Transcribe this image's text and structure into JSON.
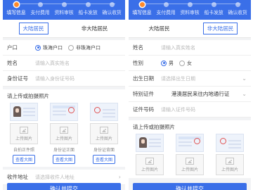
{
  "steps": [
    "填写信息",
    "支付费用",
    "资料审核",
    "船卡发放",
    "确认收货"
  ],
  "colors": {
    "primary": "#3a6fe8",
    "active_step": "#ff8a2a",
    "background": "#f2f3f5"
  },
  "left": {
    "tabs": [
      "大陆居民",
      "非大陆居民"
    ],
    "selected_tab": "大陆居民",
    "fields": {
      "hukou": {
        "label": "户口",
        "options": [
          "珠海户口",
          "非珠海户口"
        ],
        "selected": "珠海户口"
      },
      "name": {
        "label": "姓名",
        "placeholder": "请输入真实姓名"
      },
      "id_number": {
        "label": "身份证号",
        "placeholder": "请输入身份证号码"
      }
    },
    "upload": {
      "title": "请上传或拍摄照片",
      "upload_label": "上传图片",
      "items": [
        {
          "caption": "自拍正件照",
          "button": "查看大图"
        },
        {
          "caption": "身份证正面",
          "button": "查看大图"
        },
        {
          "caption": "身份证背面",
          "button": "查看大图"
        }
      ]
    },
    "address": {
      "label": "收件地址",
      "placeholder": "请选择收件人地址"
    },
    "submit": "确认并提交"
  },
  "right": {
    "tabs": [
      "大陆居民",
      "非大陆居民"
    ],
    "selected_tab": "非大陆居民",
    "fields": {
      "name": {
        "label": "姓名",
        "placeholder": "请输入真实姓名"
      },
      "gender": {
        "label": "性别",
        "options": [
          "男",
          "女"
        ],
        "selected": "男"
      },
      "birth": {
        "label": "出生日期",
        "placeholder": "请选择出生日期"
      },
      "special": {
        "label": "特别证件",
        "value": "港澳居民来往内地通行证"
      },
      "cert_number": {
        "label": "证件号码",
        "placeholder": "请输入证件号码"
      }
    },
    "upload": {
      "title": "请上传或拍摄照片",
      "upload_label": "上传图片"
    },
    "submit": "确认并提交"
  }
}
